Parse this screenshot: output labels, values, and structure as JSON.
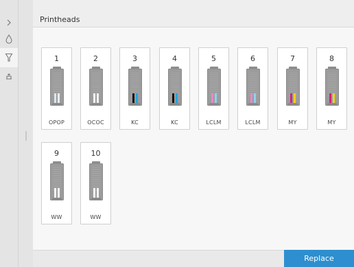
{
  "header": {
    "title": "Printheads"
  },
  "rail": {
    "items": [
      {
        "icon": "chevron-right-icon"
      },
      {
        "icon": "ink-drop-icon"
      },
      {
        "icon": "printhead-icon",
        "active": true
      },
      {
        "icon": "maintenance-icon"
      }
    ]
  },
  "printheads": [
    {
      "number": "1",
      "label": "OPOP",
      "inks": [
        "#d8e6f0",
        "#e6eef4"
      ]
    },
    {
      "number": "2",
      "label": "OCOC",
      "inks": [
        "#f2f2f2",
        "#f2f2f2"
      ]
    },
    {
      "number": "3",
      "label": "KC",
      "inks": [
        "#111111",
        "#2aa4dc"
      ]
    },
    {
      "number": "4",
      "label": "KC",
      "inks": [
        "#111111",
        "#2aa4dc"
      ]
    },
    {
      "number": "5",
      "label": "LCLM",
      "inks": [
        "#e889c8",
        "#8fd2ee"
      ]
    },
    {
      "number": "6",
      "label": "LCLM",
      "inks": [
        "#e889c8",
        "#8fd2ee"
      ]
    },
    {
      "number": "7",
      "label": "MY",
      "inks": [
        "#d4237a",
        "#f1d21b"
      ]
    },
    {
      "number": "8",
      "label": "MY",
      "inks": [
        "#d4237a",
        "#f1d21b"
      ]
    },
    {
      "number": "9",
      "label": "WW",
      "inks": [
        "#f6f6f6",
        "#f6f6f6"
      ]
    },
    {
      "number": "10",
      "label": "WW",
      "inks": [
        "#f6f6f6",
        "#f6f6f6"
      ]
    }
  ],
  "footer": {
    "replace_label": "Replace"
  },
  "colors": {
    "accent": "#2d8fcf"
  }
}
